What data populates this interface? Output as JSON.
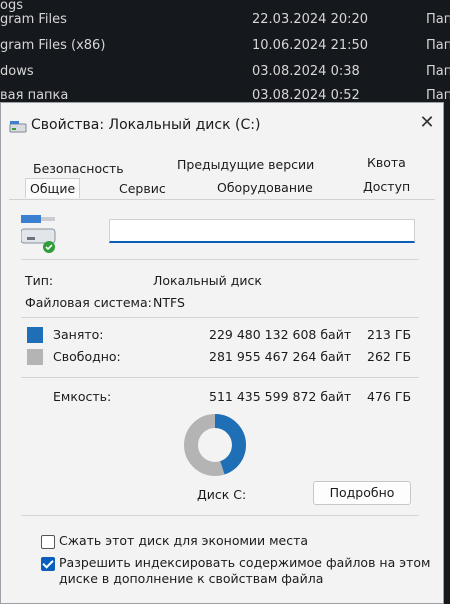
{
  "background_list": [
    {
      "name": "ogs",
      "date": "",
      "type": ""
    },
    {
      "name": "gram Files",
      "date": "22.03.2024 20:20",
      "type": "Пап"
    },
    {
      "name": "gram Files (x86)",
      "date": "10.06.2024 21:50",
      "type": "Пап"
    },
    {
      "name": "dows",
      "date": "03.08.2024 0:38",
      "type": "Пап"
    },
    {
      "name": "вая папка",
      "date": "03.08.2024 0:52",
      "type": "Пап"
    }
  ],
  "dialog": {
    "title": "Свойства: Локальный диск (C:)",
    "close_glyph": "✕",
    "tabs_row1": [
      "Безопасность",
      "Предыдущие версии",
      "Квота"
    ],
    "tabs_row2": [
      "Общие",
      "Сервис",
      "Оборудование",
      "Доступ"
    ],
    "active_tab": "Общие",
    "name_value": "",
    "type_label": "Тип:",
    "type_value": "Локальный диск",
    "fs_label": "Файловая система:",
    "fs_value": "NTFS",
    "used": {
      "label": "Занято:",
      "bytes": "229 480 132 608 байт",
      "size": "213 ГБ",
      "color": "#1e6fb5"
    },
    "free": {
      "label": "Свободно:",
      "bytes": "281 955 467 264 байт",
      "size": "262 ГБ",
      "color": "#b4b4b4"
    },
    "capacity": {
      "label": "Емкость:",
      "bytes": "511 435 599 872 байт",
      "size": "476 ГБ"
    },
    "used_fraction": 0.449,
    "disk_label": "Диск C:",
    "details_button": "Подробно",
    "compress_label": "Сжать этот диск для экономии места",
    "compress_checked": false,
    "index_label_line1": "Разрешить индексировать содержимое файлов на этом",
    "index_label_line2": "диске в дополнение к свойствам файла",
    "index_checked": true
  },
  "icons": {
    "title_icon": "drive-icon",
    "drive_icon": "drive-check-icon"
  }
}
